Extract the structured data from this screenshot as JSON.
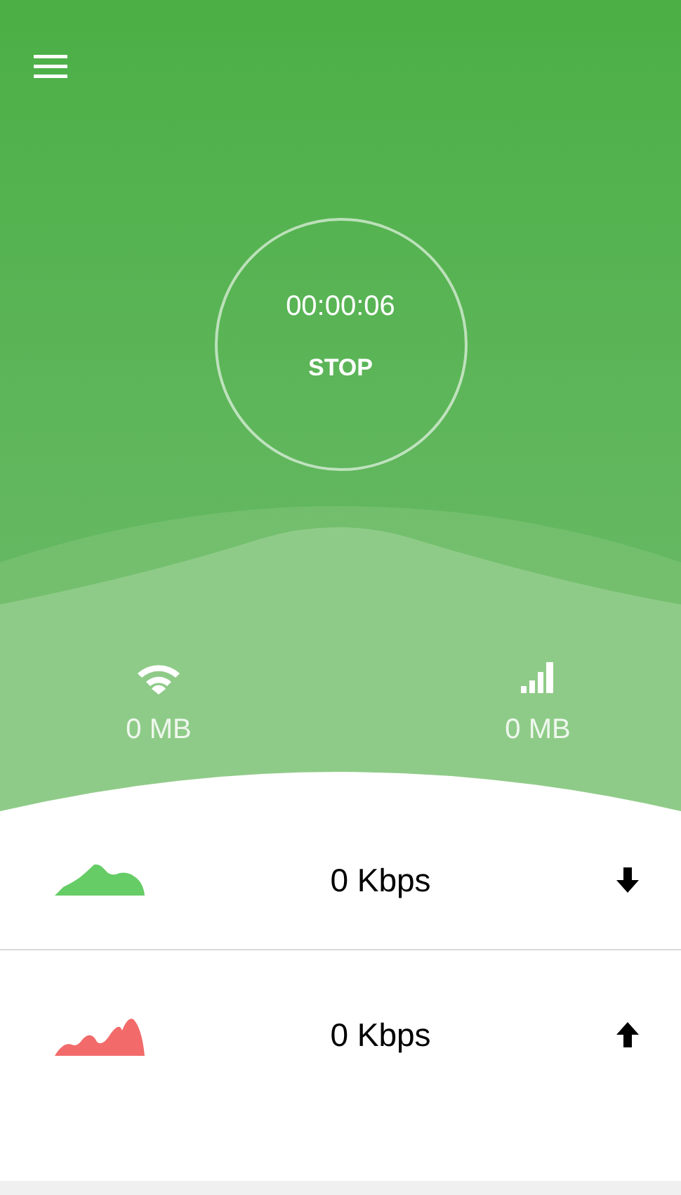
{
  "timer": {
    "elapsed": "00:00:06",
    "action": "STOP"
  },
  "usage": [
    {
      "kind": "wifi",
      "amount": "0 MB"
    },
    {
      "kind": "cellular",
      "amount": "0 MB"
    }
  ],
  "rates": [
    {
      "kind": "download",
      "color": "#66cc66",
      "speed": "0 Kbps"
    },
    {
      "kind": "upload",
      "color": "#f26a6a",
      "speed": "0 Kbps"
    }
  ]
}
